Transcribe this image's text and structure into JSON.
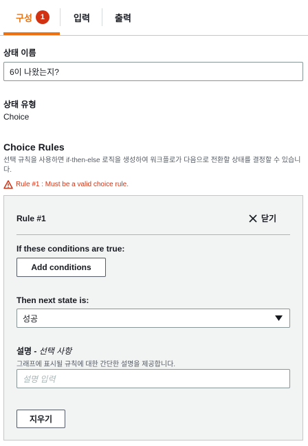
{
  "tabs": {
    "config": {
      "label": "구성",
      "badge": "1"
    },
    "input": {
      "label": "입력"
    },
    "output": {
      "label": "출력"
    }
  },
  "state_name": {
    "label": "상태 이름",
    "value": "6이 나왔는지?"
  },
  "state_type": {
    "label": "상태 유형",
    "value": "Choice"
  },
  "choice_rules": {
    "title": "Choice Rules",
    "description": "선택 규칙을 사용하면 if-then-else 로직을 생성하여 워크플로가 다음으로 전환할 상태를 결정할 수 있습니다.",
    "error": "Rule #1 : Must be a valid choice rule."
  },
  "rule": {
    "title": "Rule #1",
    "close_label": "닫기",
    "conditions_label": "If these conditions are true:",
    "add_conditions_label": "Add conditions",
    "next_state_label": "Then next state is:",
    "next_state_value": "성공",
    "comment_label": "설명 - ",
    "comment_optional": "선택 사항",
    "comment_hint": "그래프에 표시될 규칙에 대한 간단한 설명을 제공합니다.",
    "comment_placeholder": "설명 입력",
    "clear_label": "지우기"
  },
  "colors": {
    "accent": "#ec7211",
    "error": "#d13212"
  }
}
